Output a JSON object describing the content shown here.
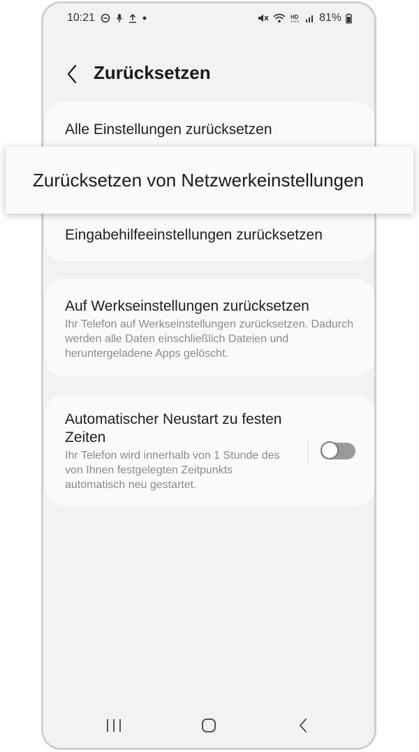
{
  "status_bar": {
    "time": "10:21",
    "battery": "81%"
  },
  "header": {
    "title": "Zurücksetzen"
  },
  "reset_card": {
    "items": [
      {
        "label": "Alle Einstellungen zurücksetzen"
      },
      {
        "label": "Zurücksetzen von Netzwerkeinstellungen"
      },
      {
        "label": "Eingabehilfeeinstellungen zurücksetzen"
      }
    ]
  },
  "factory_card": {
    "title": "Auf Werkseinstellungen zurücksetzen",
    "description": "Ihr Telefon auf Werkseinstellungen zurücksetzen. Dadurch werden alle Daten einschließlich Dateien und heruntergeladene Apps gelöscht."
  },
  "auto_restart_card": {
    "title": "Automatischer Neustart zu festen Zeiten",
    "description": "Ihr Telefon wird innerhalb von 1 Stunde des von Ihnen festgelegten Zeitpunkts automatisch neu gestartet.",
    "toggle_on": false
  },
  "icons": {
    "status_left": [
      "do-not-disturb-icon",
      "microphone-icon",
      "upload-icon",
      "notification-dot-icon"
    ],
    "status_right": [
      "mute-icon",
      "wifi-icon",
      "hd-voice-icon",
      "signal-icon",
      "battery-icon"
    ],
    "nav": [
      "recents-icon",
      "home-icon",
      "back-icon"
    ]
  },
  "colors": {
    "background": "#f2f2f2",
    "card": "#fafafa",
    "toggle_off": "#9a9a9a"
  }
}
